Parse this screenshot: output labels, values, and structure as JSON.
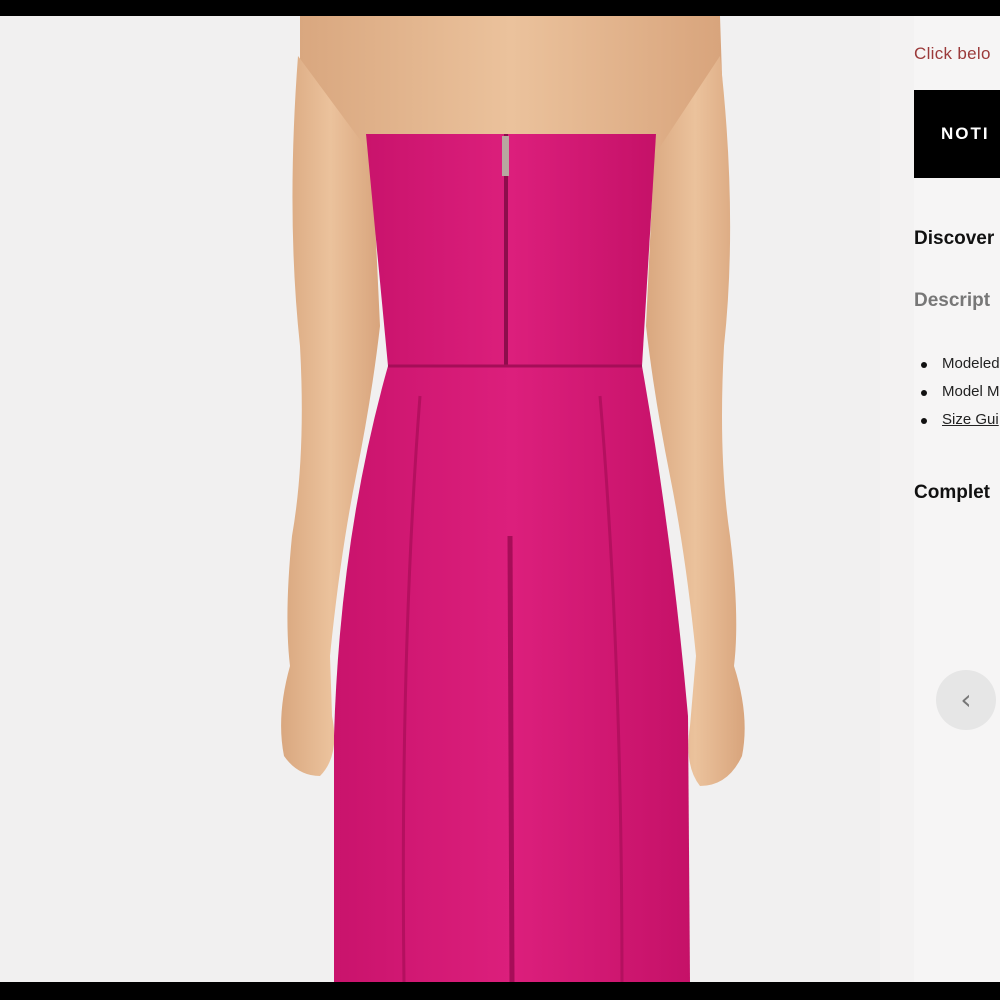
{
  "details": {
    "notice_link": "Click belo",
    "notify_button": "NOTI",
    "discover_heading": "Discover",
    "description_heading": "Descript",
    "list_items": [
      "Modeled",
      "Model M",
      "Size Gui"
    ],
    "complete_heading": "Complet"
  },
  "carousel": {
    "prev_icon": "chevron-left-icon",
    "prev_glyph": "‹"
  },
  "product_image": {
    "subject": "back view of strapless pink midi dress",
    "dress_color": "#d81b78",
    "skin_color": "#e7bb93"
  },
  "colors": {
    "link": "#9b3a3a",
    "button_bg": "#000000",
    "page_bg": "#f3f2f2"
  }
}
